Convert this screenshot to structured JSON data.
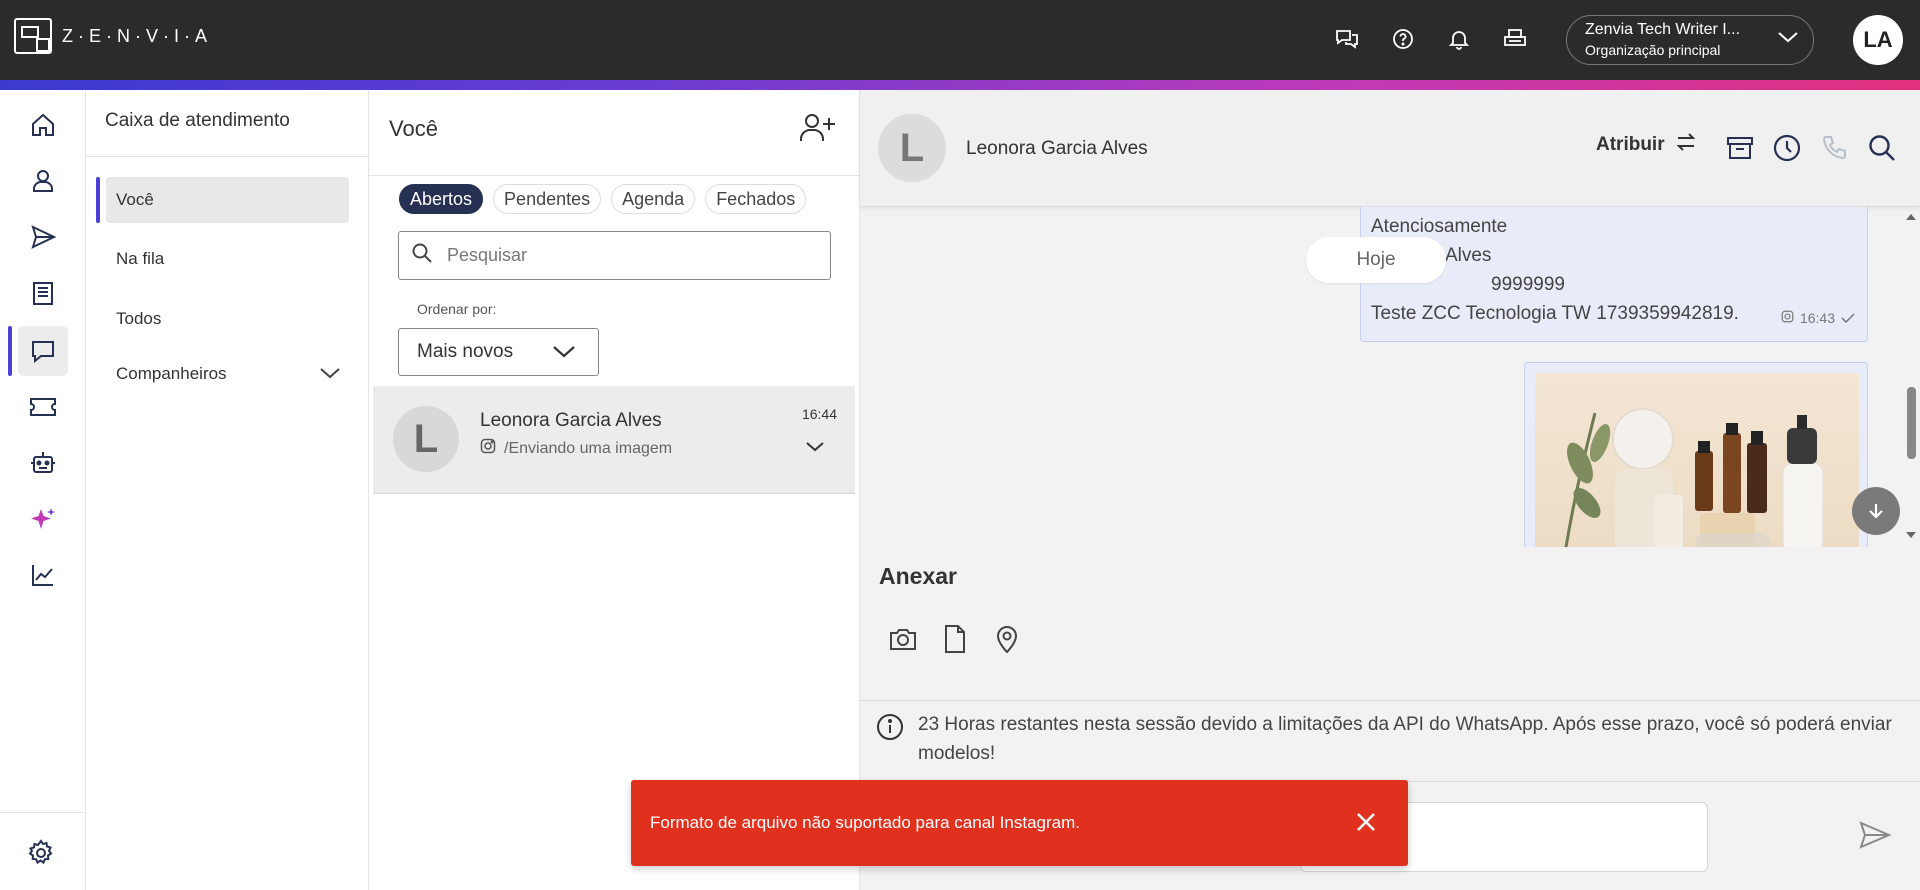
{
  "brand": {
    "logo_text": "Z·E·N·V·I·A"
  },
  "topbar": {
    "icons": [
      "chat-bubbles-icon",
      "help-icon",
      "bell-icon",
      "printer-icon"
    ],
    "org": {
      "name": "Zenvia Tech Writer I...",
      "subtitle": "Organização principal"
    },
    "avatar_initials": "LA"
  },
  "leftnav": {
    "items": [
      "home-icon",
      "user-icon",
      "send-icon",
      "document-icon",
      "chat-icon",
      "ticket-icon",
      "bot-icon",
      "sparkle-icon",
      "analytics-icon"
    ],
    "active": "chat-icon",
    "settings": "gear-icon"
  },
  "inbox": {
    "title": "Caixa de atendimento",
    "items": [
      {
        "label": "Você"
      },
      {
        "label": "Na fila"
      },
      {
        "label": "Todos"
      },
      {
        "label": "Companheiros"
      }
    ]
  },
  "conversations": {
    "title": "Você",
    "tabs": [
      "Abertos",
      "Pendentes",
      "Agenda",
      "Fechados"
    ],
    "active_tab": "Abertos",
    "search_placeholder": "Pesquisar",
    "sort_label": "Ordenar por:",
    "sort_value": "Mais novos",
    "list": [
      {
        "initial": "L",
        "name": "Leonora Garcia Alves",
        "preview": "/Enviando uma imagem",
        "time": "16:44"
      }
    ]
  },
  "chat": {
    "contact_initial": "L",
    "contact_name": "Leonora Garcia Alves",
    "assign_label": "Atribuir",
    "message": {
      "lines": [
        "Atenciosamente",
        "Leonora Alves",
        "9999999",
        "Teste ZCC Tecnologia TW 1739359942819."
      ],
      "time": "16:43"
    },
    "date_separator": "Hoje",
    "attach_title": "Anexar",
    "attach_icons": [
      "camera-icon",
      "file-icon",
      "location-icon"
    ],
    "session_text": "23 Horas restantes nesta sessão devido a limitações da API do WhatsApp. Após esse prazo, você só poderá enviar modelos!"
  },
  "toast": {
    "message": "Formato de arquivo não suportado para canal Instagram."
  },
  "colors": {
    "accent": "#4b3fd8",
    "toast": "#e0301e",
    "topbar": "#2b2b2b",
    "active_tab": "#253052"
  }
}
